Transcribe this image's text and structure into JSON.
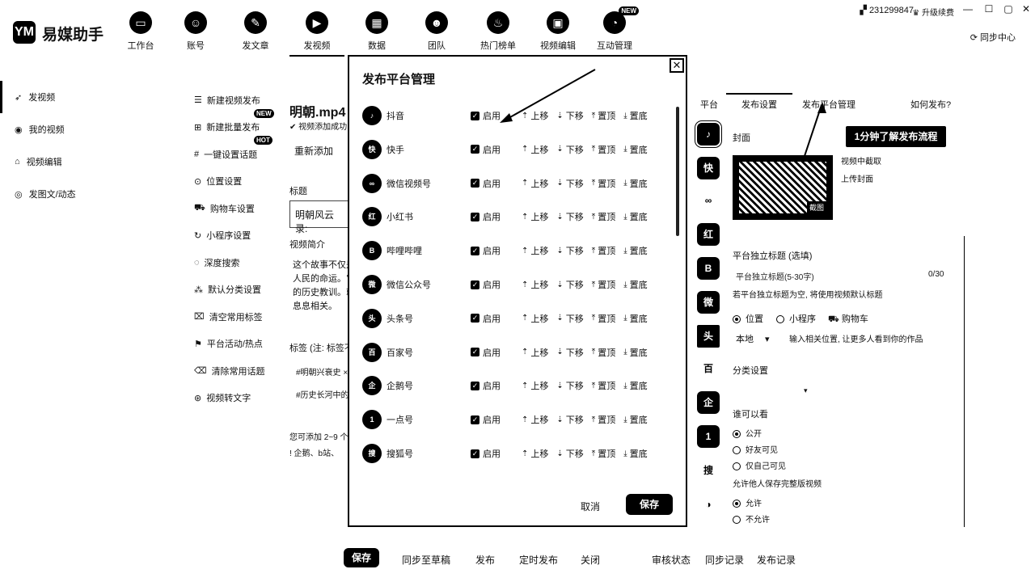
{
  "app": {
    "logo_mark": "YM",
    "title": "易媒助手",
    "user_id": "231299847",
    "upgrade": "升级续费",
    "sync_center": "同步中心"
  },
  "nav": [
    {
      "label": "工作台",
      "icon": "monitor-icon"
    },
    {
      "label": "账号",
      "icon": "user-icon"
    },
    {
      "label": "发文章",
      "icon": "pen-icon"
    },
    {
      "label": "发视频",
      "icon": "play-icon",
      "active": true
    },
    {
      "label": "数据",
      "icon": "chart-icon"
    },
    {
      "label": "团队",
      "icon": "team-icon"
    },
    {
      "label": "热门榜单",
      "icon": "fire-icon"
    },
    {
      "label": "视频编辑",
      "icon": "briefcase-icon"
    },
    {
      "label": "互动管理",
      "icon": "chat-icon",
      "badge": "NEW"
    }
  ],
  "sidebar": [
    {
      "label": "发视频",
      "icon": "send-icon",
      "active": true
    },
    {
      "label": "我的视频",
      "icon": "video-icon"
    },
    {
      "label": "视频编辑",
      "icon": "edit-icon"
    },
    {
      "label": "发图文/动态",
      "icon": "image-icon"
    }
  ],
  "subnav": [
    {
      "label": "新建视频发布",
      "icon": "new-doc-icon"
    },
    {
      "label": "新建批量发布",
      "icon": "batch-icon",
      "badge": "NEW"
    },
    {
      "label": "一键设置话题",
      "icon": "hash-icon",
      "badge": "HOT"
    },
    {
      "label": "位置设置",
      "icon": "location-icon"
    },
    {
      "label": "购物车设置",
      "icon": "cart-icon"
    },
    {
      "label": "小程序设置",
      "icon": "miniapp-icon"
    },
    {
      "label": "深度搜索",
      "icon": "search-icon"
    },
    {
      "label": "默认分类设置",
      "icon": "category-icon"
    },
    {
      "label": "清空常用标签",
      "icon": "clear-tag-icon"
    },
    {
      "label": "平台活动/热点",
      "icon": "flag-icon"
    },
    {
      "label": "清除常用话题",
      "icon": "clear-topic-icon"
    },
    {
      "label": "视频转文字",
      "icon": "transcribe-icon"
    }
  ],
  "main": {
    "file_name": "明朝.mp4",
    "upload_status": "视频添加成功",
    "re_add": "重新添加",
    "title_label": "标题",
    "title_value": "明朝风云录:",
    "desc_label": "视频简介",
    "desc_lines": [
      "这个故事不仅是",
      "人民的命运。它",
      "的历史教训。就",
      "息息相关。"
    ],
    "tags_label": "标签 (注: 标签不",
    "tags": [
      "#明朝兴衰史 ×",
      "#历史长河中的"
    ],
    "tip": "您可添加 2~9 个",
    "tip2": "! 企鹅、b站、"
  },
  "modal": {
    "title": "发布平台管理",
    "enable_label": "启用",
    "actions": {
      "top": "上移",
      "down": "下移",
      "pin": "置顶",
      "bottom": "置底"
    },
    "platforms": [
      {
        "name": "抖音",
        "icon": "douyin-icon",
        "glyph": "♪"
      },
      {
        "name": "快手",
        "icon": "kuaishou-icon",
        "glyph": "快"
      },
      {
        "name": "微信视频号",
        "icon": "wechat-channels-icon",
        "glyph": "∞"
      },
      {
        "name": "小红书",
        "icon": "xiaohongshu-icon",
        "glyph": "红"
      },
      {
        "name": "哔哩哔哩",
        "icon": "bilibili-icon",
        "glyph": "B"
      },
      {
        "name": "微信公众号",
        "icon": "wechat-official-icon",
        "glyph": "微"
      },
      {
        "name": "头条号",
        "icon": "toutiao-icon",
        "glyph": "头"
      },
      {
        "name": "百家号",
        "icon": "baijiahao-icon",
        "glyph": "百"
      },
      {
        "name": "企鹅号",
        "icon": "qie-icon",
        "glyph": "企"
      },
      {
        "name": "一点号",
        "icon": "yidian-icon",
        "glyph": "1"
      },
      {
        "name": "搜狐号",
        "icon": "sohu-icon",
        "glyph": "搜"
      }
    ],
    "cancel": "取消",
    "save": "保存"
  },
  "right": {
    "tabs": [
      "平台",
      "发布设置",
      "发布平台管理",
      "如何发布?"
    ],
    "callout": "1分钟了解发布流程",
    "cover_label": "封面",
    "cover_badge": "截图",
    "cover_actions": [
      "视频中截取",
      "上传封面"
    ],
    "platform_title_label": "平台独立标题 (选填)",
    "platform_title_placeholder": "平台独立标题(5-30字)",
    "counter": "0/30",
    "hint": "若平台独立标题为空, 将使用视频默认标题",
    "options": [
      "位置",
      "小程序",
      "购物车"
    ],
    "local": "本地",
    "location_hint": "输入相关位置, 让更多人看到你的作品",
    "category": "分类设置",
    "who_can_see": "谁可以看",
    "visibility": [
      "公开",
      "好友可见",
      "仅自己可见"
    ],
    "allow_save": "允许他人保存完整版视频",
    "allow": [
      "允许",
      "不允许"
    ]
  },
  "bottom": {
    "save": "保存",
    "sync_draft": "同步至草稿",
    "publish": "发布",
    "schedule": "定时发布",
    "close": "关闭",
    "review": "审核状态",
    "sync_log": "同步记录",
    "publish_log": "发布记录"
  }
}
